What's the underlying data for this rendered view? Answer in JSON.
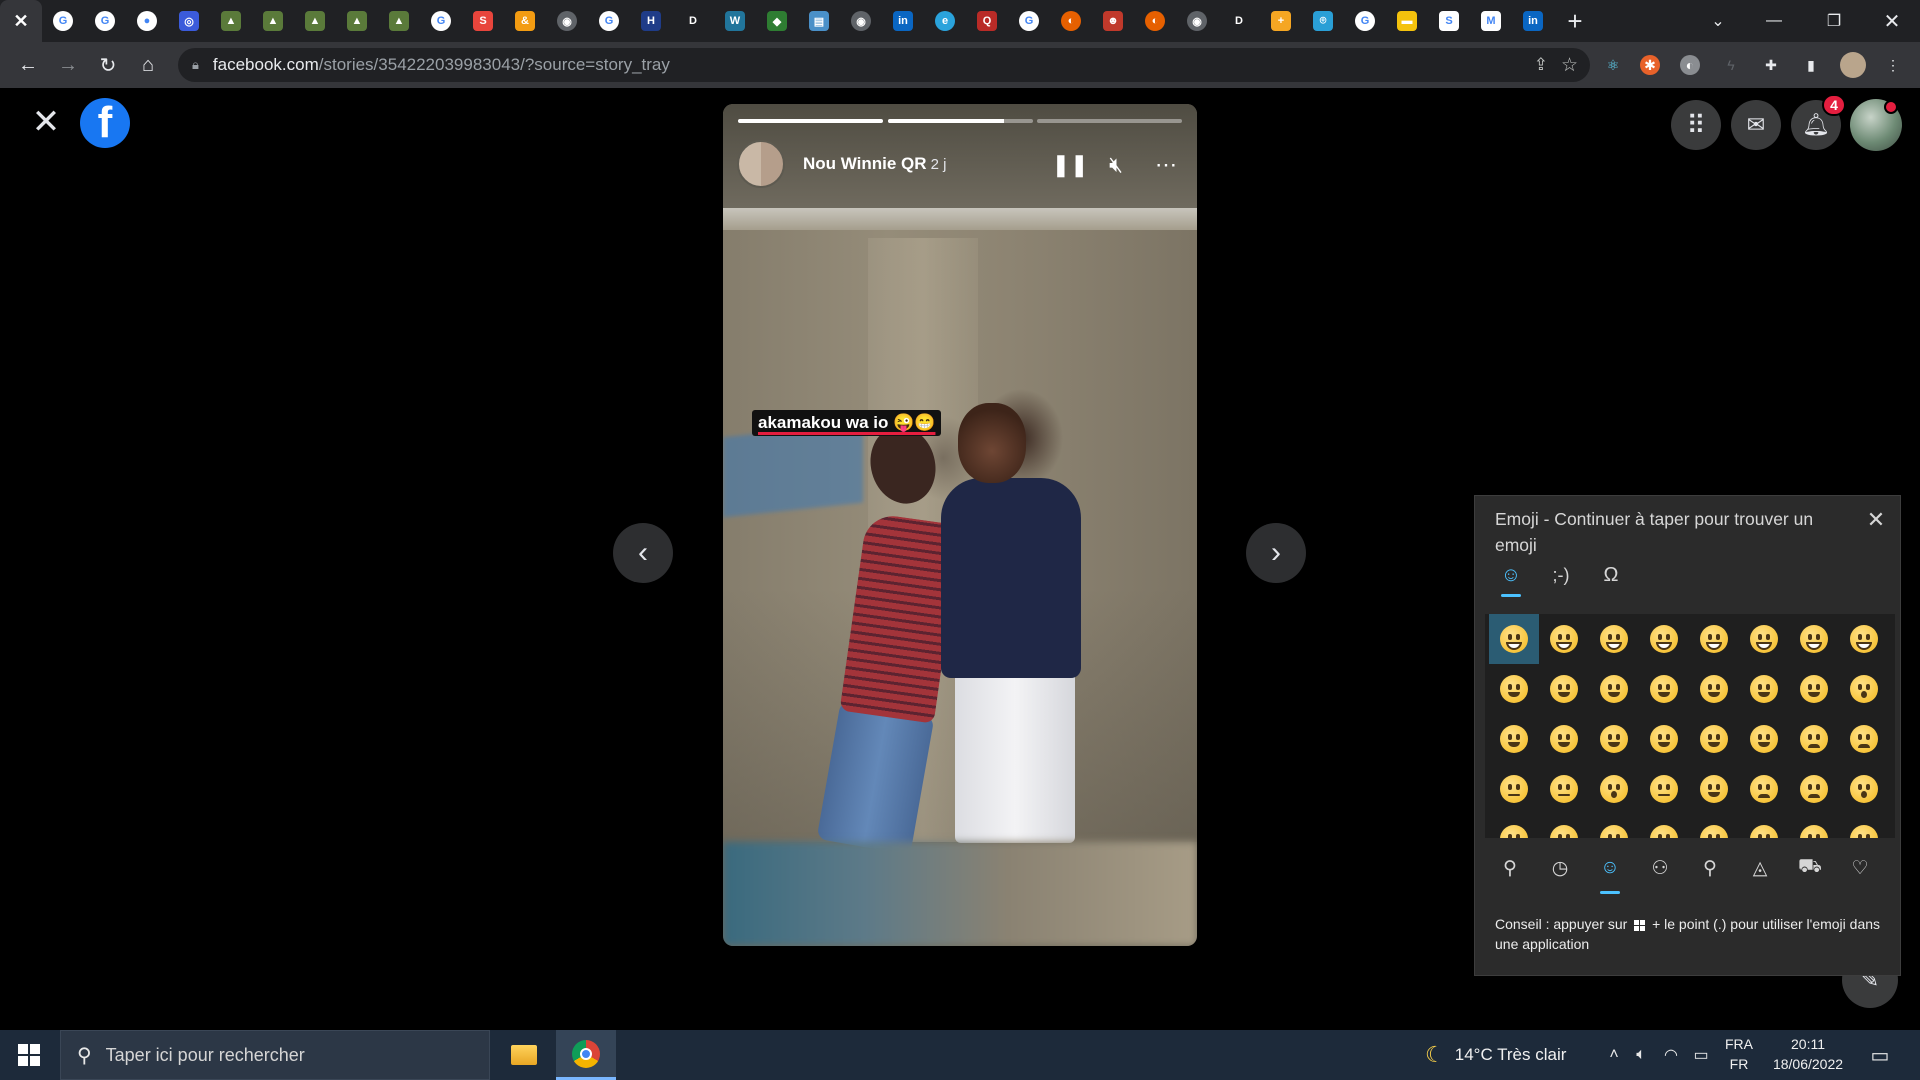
{
  "browser": {
    "tabs": [
      {
        "icon": "close-icon",
        "active": true,
        "color": "#35363a",
        "glyph": "✕"
      },
      {
        "icon": "google-icon",
        "color": "#ffffff",
        "glyph": "G"
      },
      {
        "icon": "google-icon",
        "color": "#ffffff",
        "glyph": "G"
      },
      {
        "icon": "github-icon",
        "color": "#ffffff",
        "glyph": "●"
      },
      {
        "icon": "fingerprint-icon",
        "color": "#3b5bdb",
        "glyph": "◎"
      },
      {
        "icon": "image-icon",
        "color": "#5a7a3a",
        "glyph": "▲"
      },
      {
        "icon": "image-icon",
        "color": "#5a7a3a",
        "glyph": "▲"
      },
      {
        "icon": "image-icon",
        "color": "#5a7a3a",
        "glyph": "▲"
      },
      {
        "icon": "image-icon",
        "color": "#5a7a3a",
        "glyph": "▲"
      },
      {
        "icon": "image-icon",
        "color": "#5a7a3a",
        "glyph": "▲"
      },
      {
        "icon": "google-icon",
        "color": "#ffffff",
        "glyph": "G"
      },
      {
        "icon": "app-icon",
        "color": "#e8453c",
        "glyph": "S"
      },
      {
        "icon": "ampersand-icon",
        "color": "#f39c12",
        "glyph": "&"
      },
      {
        "icon": "globe-icon",
        "color": "#5f6368",
        "glyph": "◉"
      },
      {
        "icon": "google-icon",
        "color": "#ffffff",
        "glyph": "G"
      },
      {
        "icon": "h-icon",
        "color": "#1f3c88",
        "glyph": "H"
      },
      {
        "icon": "d-icon",
        "color": "#202124",
        "glyph": "D"
      },
      {
        "icon": "wordpress-icon",
        "color": "#21759b",
        "glyph": "W"
      },
      {
        "icon": "android-icon",
        "color": "#2e7d32",
        "glyph": "◆"
      },
      {
        "icon": "doc-icon",
        "color": "#4a90c8",
        "glyph": "▤"
      },
      {
        "icon": "globe-icon",
        "color": "#5f6368",
        "glyph": "◉"
      },
      {
        "icon": "linkedin-icon",
        "color": "#0a66c2",
        "glyph": "in"
      },
      {
        "icon": "edge-icon",
        "color": "#2aa3dc",
        "glyph": "e"
      },
      {
        "icon": "quora-icon",
        "color": "#b92b27",
        "glyph": "Q"
      },
      {
        "icon": "google-icon",
        "color": "#ffffff",
        "glyph": "G"
      },
      {
        "icon": "firefox-icon",
        "color": "#e66000",
        "glyph": "◐"
      },
      {
        "icon": "owl-icon",
        "color": "#c0392b",
        "glyph": "☻"
      },
      {
        "icon": "firefox-icon",
        "color": "#e66000",
        "glyph": "◐"
      },
      {
        "icon": "globe-icon",
        "color": "#5f6368",
        "glyph": "◉"
      },
      {
        "icon": "d-icon",
        "color": "#202124",
        "glyph": "D"
      },
      {
        "icon": "plus-app-icon",
        "color": "#f5a623",
        "glyph": "+"
      },
      {
        "icon": "location-icon",
        "color": "#2a9fd6",
        "glyph": "⌾"
      },
      {
        "icon": "google-icon",
        "color": "#ffffff",
        "glyph": "G"
      },
      {
        "icon": "note-icon",
        "color": "#f4c20d",
        "glyph": "▬"
      },
      {
        "icon": "s-icon",
        "color": "#ffffff",
        "glyph": "S"
      },
      {
        "icon": "gmail-icon",
        "color": "#ffffff",
        "glyph": "M"
      },
      {
        "icon": "linkedin-icon",
        "color": "#0a66c2",
        "glyph": "in"
      }
    ],
    "url_host": "facebook.com",
    "url_path": "/stories/354222039983043/?source=story_tray"
  },
  "facebook": {
    "notification_count": "4",
    "story": {
      "author": "Nou Winnie QR",
      "time": "2 j",
      "caption": "akamakou wa io 😜😁",
      "progress": [
        1.0,
        0.8,
        0.0
      ]
    }
  },
  "emoji_panel": {
    "title": "Emoji - Continuer à taper pour trouver un emoji",
    "tip_before": "Conseil : appuyer sur",
    "tip_after": "+ le point (.) pour utiliser l'emoji dans une application",
    "tabs": [
      "smiley-tab",
      "kaomoji-tab",
      "symbols-tab"
    ],
    "categories": [
      "search",
      "recent",
      "smileys",
      "people",
      "celebrations",
      "food",
      "travel",
      "hearts"
    ]
  },
  "taskbar": {
    "search_placeholder": "Taper ici pour rechercher",
    "weather": "14°C  Très clair",
    "lang_top": "FRA",
    "lang_bottom": "FR",
    "time": "20:11",
    "date": "18/06/2022"
  }
}
